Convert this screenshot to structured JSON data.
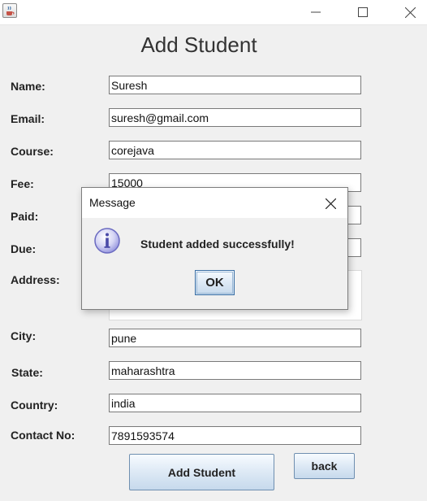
{
  "window": {
    "icon": "java-cup-icon",
    "controls": [
      "minimize-icon",
      "maximize-icon",
      "close-icon"
    ]
  },
  "form": {
    "title": "Add Student",
    "fields": {
      "name": {
        "label": "Name:",
        "value": "Suresh"
      },
      "email": {
        "label": "Email:",
        "value": "suresh@gmail.com"
      },
      "course": {
        "label": "Course:",
        "value": "corejava"
      },
      "fee": {
        "label": "Fee:",
        "value": "15000"
      },
      "paid": {
        "label": "Paid:",
        "value": ""
      },
      "due": {
        "label": "Due:",
        "value": ""
      },
      "address": {
        "label": "Address:",
        "value": ""
      },
      "city": {
        "label": "City:",
        "value": "pune"
      },
      "state": {
        "label": "State:",
        "value": "maharashtra"
      },
      "country": {
        "label": "Country:",
        "value": "india"
      },
      "contact": {
        "label": "Contact No:",
        "value": "7891593574"
      }
    },
    "add_button": "Add Student",
    "back_button": "back"
  },
  "dialog": {
    "title": "Message",
    "icon": "info-icon",
    "message": "Student added successfully!",
    "ok_button": "OK"
  },
  "colors": {
    "window_bg": "#f0f0f0",
    "button_border": "#6f8fb0",
    "info_icon": "#8a8ad6"
  }
}
